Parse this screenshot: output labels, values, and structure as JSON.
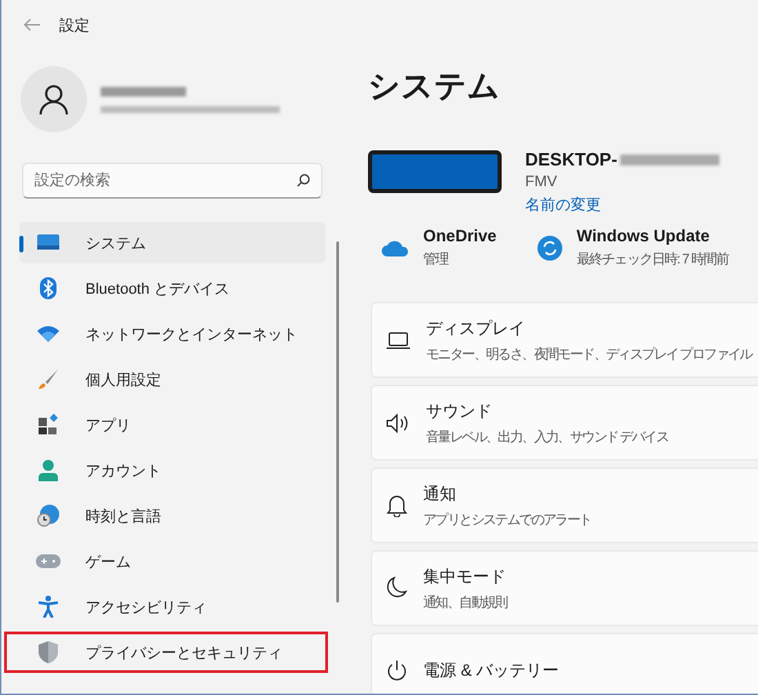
{
  "window": {
    "title": "設定"
  },
  "search": {
    "placeholder": "設定の検索"
  },
  "nav": [
    {
      "label": "システム",
      "selected": true,
      "highlighted": false
    },
    {
      "label": "Bluetooth とデバイス",
      "selected": false,
      "highlighted": false
    },
    {
      "label": "ネットワークとインターネット",
      "selected": false,
      "highlighted": false
    },
    {
      "label": "個人用設定",
      "selected": false,
      "highlighted": false
    },
    {
      "label": "アプリ",
      "selected": false,
      "highlighted": false
    },
    {
      "label": "アカウント",
      "selected": false,
      "highlighted": false
    },
    {
      "label": "時刻と言語",
      "selected": false,
      "highlighted": false
    },
    {
      "label": "ゲーム",
      "selected": false,
      "highlighted": false
    },
    {
      "label": "アクセシビリティ",
      "selected": false,
      "highlighted": false
    },
    {
      "label": "プライバシーとセキュリティ",
      "selected": false,
      "highlighted": true
    }
  ],
  "page": {
    "title": "システム"
  },
  "device": {
    "name": "DESKTOP-",
    "model": "FMV",
    "rename_link": "名前の変更"
  },
  "quick": [
    {
      "title": "OneDrive",
      "subtitle": "管理"
    },
    {
      "title": "Windows Update",
      "subtitle": "最終チェック日時: 7 時間前"
    }
  ],
  "cards": [
    {
      "title": "ディスプレイ",
      "subtitle": "モニター、明るさ、夜間モード、ディスプレイ プロファイル"
    },
    {
      "title": "サウンド",
      "subtitle": "音量レベル、出力、入力、サウンド デバイス"
    },
    {
      "title": "通知",
      "subtitle": "アプリとシステムでのアラート"
    },
    {
      "title": "集中モード",
      "subtitle": "通知、自動規則"
    },
    {
      "title": "電源 & バッテリー"
    }
  ]
}
